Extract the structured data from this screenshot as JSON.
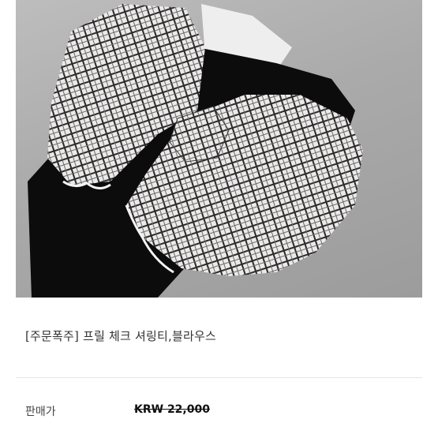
{
  "product": {
    "image_alt_icon": "product-photo",
    "title": "[주문폭주] 프릴 체크 셔링티,블라우스",
    "price_label": "판매가",
    "price_value": "KRW 22,000"
  },
  "colors": {
    "background": "#ffffff",
    "photo_bg": "#aaaaaa",
    "fabric_dark": "#0c0c0c",
    "plaid_light": "#e9e6e6",
    "plaid_dark": "#2b2b2b"
  }
}
